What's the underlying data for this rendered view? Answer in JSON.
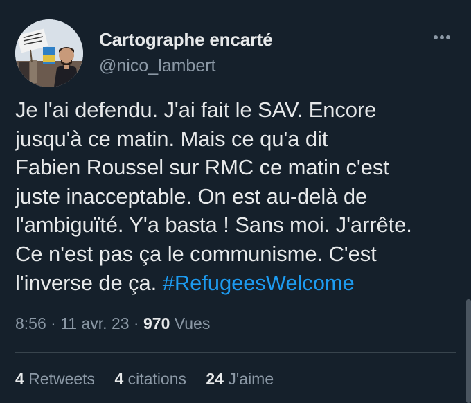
{
  "author": {
    "display_name": "Cartographe encarté",
    "handle": "@nico_lambert",
    "avatar_sign_text": "SOLIDARITÉ AVEC LES EXILÉS"
  },
  "tweet": {
    "lines": [
      "Je l'ai defendu. J'ai fait le SAV. Encore",
      "jusqu'à ce matin. Mais ce qu'a dit",
      "Fabien Roussel sur RMC ce matin c'est",
      "juste inacceptable. On est au-delà de",
      "l'ambiguïté. Y'a basta ! Sans moi. J'arrête.",
      "Ce n'est pas ça le communisme. C'est"
    ],
    "last_line_text": "l'inverse de ça. ",
    "hashtag": "#RefugeesWelcome"
  },
  "meta": {
    "time": "8:56",
    "separator": " · ",
    "date": "11 avr. 23",
    "views_count": "970",
    "views_label": " Vues"
  },
  "stats": {
    "retweets_count": "4",
    "retweets_label": " Retweets",
    "quotes_count": "4",
    "quotes_label": " citations",
    "likes_count": "24",
    "likes_label": " J'aime"
  },
  "colors": {
    "background": "#15202b",
    "text": "#e7e9ea",
    "secondary": "#8b98a5",
    "link": "#1d9bf0",
    "divider": "#38444d"
  },
  "icons": {
    "more": "more-horizontal-icon"
  }
}
